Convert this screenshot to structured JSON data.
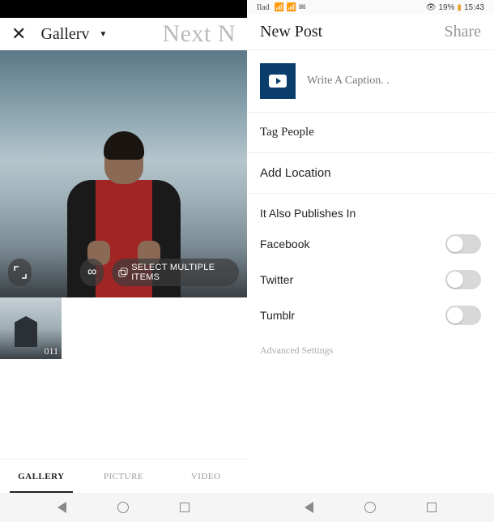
{
  "left": {
    "header": {
      "source_label": "Gallerv",
      "next_label": "Next N"
    },
    "preview": {
      "select_multiple_label": "SELECT MULTIPLE ITEMS"
    },
    "thumbs": [
      {
        "duration": "011"
      }
    ],
    "tabs": {
      "gallery": "GALLERY",
      "picture": "PICTURE",
      "video": "VIDEO"
    }
  },
  "right": {
    "status": {
      "carrier": "Ilad",
      "battery": "19%",
      "time": "15:43"
    },
    "header": {
      "title": "New Post",
      "share": "Share"
    },
    "caption_placeholder": "Write A Caption. .",
    "options": {
      "tag_people": "Tag People",
      "add_location": "Add Location",
      "also_publishes": "It Also Publishes In"
    },
    "toggles": {
      "facebook": "Facebook",
      "twitter": "Twitter",
      "tumblr": "Tumblr"
    },
    "advanced": "Advanced Settings"
  }
}
